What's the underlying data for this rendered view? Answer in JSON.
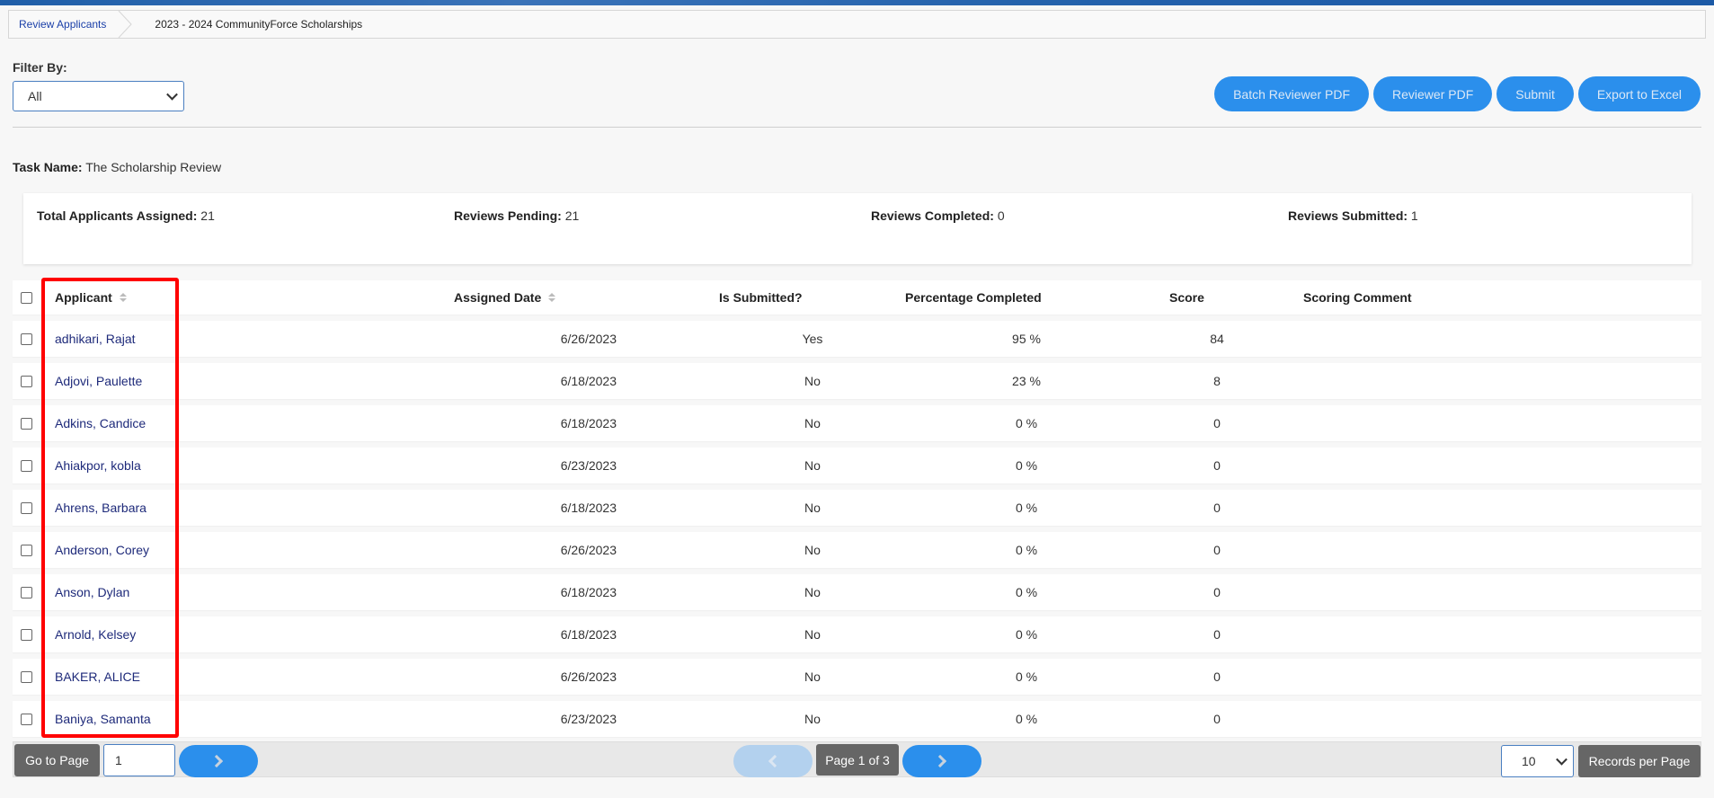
{
  "breadcrumb": {
    "link": "Review Applicants",
    "current": "2023 - 2024 CommunityForce Scholarships"
  },
  "filter": {
    "label": "Filter By:",
    "selected": "All"
  },
  "actions": {
    "batch_reviewer_pdf": "Batch Reviewer PDF",
    "reviewer_pdf": "Reviewer PDF",
    "submit": "Submit",
    "export_excel": "Export to Excel"
  },
  "task": {
    "label": "Task Name:",
    "value": "The Scholarship Review"
  },
  "stats": {
    "total_label": "Total Applicants Assigned:",
    "total_value": "21",
    "pending_label": "Reviews Pending:",
    "pending_value": "21",
    "completed_label": "Reviews Completed:",
    "completed_value": "0",
    "submitted_label": "Reviews Submitted:",
    "submitted_value": "1"
  },
  "table": {
    "headers": {
      "applicant": "Applicant",
      "assigned_date": "Assigned Date",
      "is_submitted": "Is Submitted?",
      "percentage": "Percentage Completed",
      "score": "Score",
      "comment": "Scoring Comment"
    },
    "rows": [
      {
        "applicant": "adhikari, Rajat",
        "date": "6/26/2023",
        "submitted": "Yes",
        "percent": "95 %",
        "score": "84",
        "comment": ""
      },
      {
        "applicant": "Adjovi, Paulette",
        "date": "6/18/2023",
        "submitted": "No",
        "percent": "23 %",
        "score": "8",
        "comment": ""
      },
      {
        "applicant": "Adkins, Candice",
        "date": "6/18/2023",
        "submitted": "No",
        "percent": "0 %",
        "score": "0",
        "comment": ""
      },
      {
        "applicant": "Ahiakpor, kobla",
        "date": "6/23/2023",
        "submitted": "No",
        "percent": "0 %",
        "score": "0",
        "comment": ""
      },
      {
        "applicant": "Ahrens, Barbara",
        "date": "6/18/2023",
        "submitted": "No",
        "percent": "0 %",
        "score": "0",
        "comment": ""
      },
      {
        "applicant": "Anderson, Corey",
        "date": "6/26/2023",
        "submitted": "No",
        "percent": "0 %",
        "score": "0",
        "comment": ""
      },
      {
        "applicant": "Anson, Dylan",
        "date": "6/18/2023",
        "submitted": "No",
        "percent": "0 %",
        "score": "0",
        "comment": ""
      },
      {
        "applicant": "Arnold, Kelsey",
        "date": "6/18/2023",
        "submitted": "No",
        "percent": "0 %",
        "score": "0",
        "comment": ""
      },
      {
        "applicant": "BAKER, ALICE",
        "date": "6/26/2023",
        "submitted": "No",
        "percent": "0 %",
        "score": "0",
        "comment": ""
      },
      {
        "applicant": "Baniya, Samanta",
        "date": "6/23/2023",
        "submitted": "No",
        "percent": "0 %",
        "score": "0",
        "comment": ""
      }
    ]
  },
  "pagination": {
    "go_to_page_label": "Go to Page",
    "page_input_value": "1",
    "page_indicator": "Page 1 of 3",
    "records_per_page_value": "10",
    "records_per_page_label": "Records per Page"
  },
  "icons": {
    "breadcrumb_separator": "chevron-right",
    "select_chevron": "chevron-down",
    "sort": "sort-up-down",
    "next": "chevron-right",
    "prev": "chevron-left"
  },
  "colors": {
    "primary_button": "#2b8fec",
    "dark_button": "#666666",
    "link": "#1e2a7a",
    "highlight": "#ff0000"
  }
}
